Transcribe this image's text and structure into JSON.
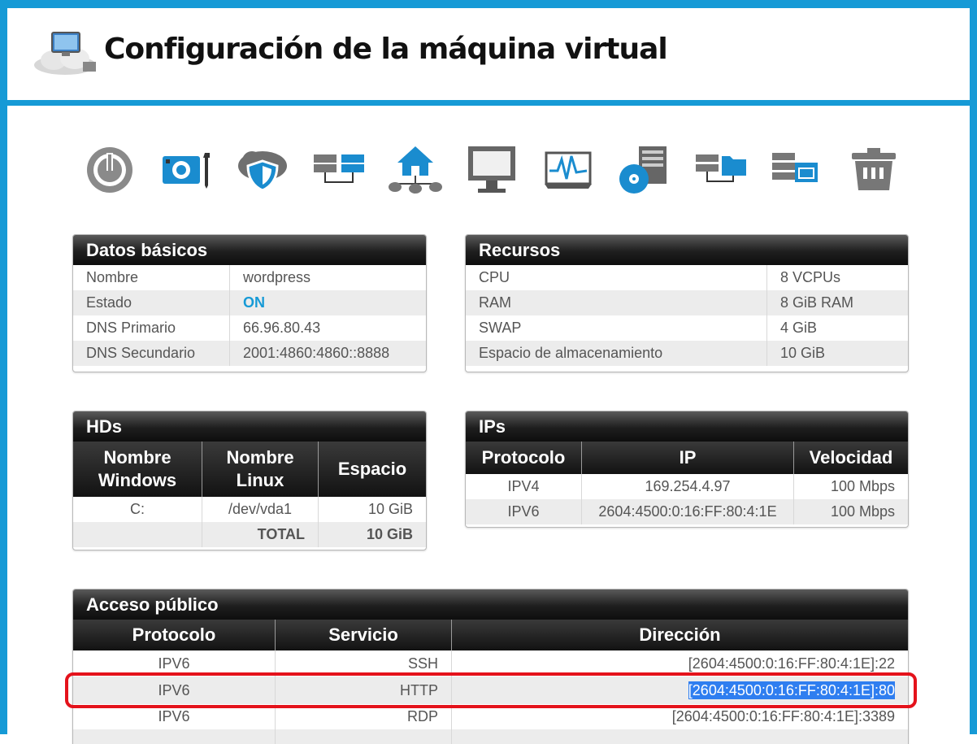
{
  "header": {
    "title": "Configuración de la máquina virtual",
    "logo_icon": "cloud-computer-icon"
  },
  "toolbar": {
    "icons": [
      "power-icon",
      "tools-icon",
      "shield-cloud-icon",
      "servers-icon",
      "network-home-icon",
      "monitor-icon",
      "activity-monitor-icon",
      "disk-server-icon",
      "server-folder-icon",
      "server-window-icon",
      "trash-icon"
    ]
  },
  "basic": {
    "title": "Datos básicos",
    "rows": [
      {
        "label": "Nombre",
        "value": "wordpress"
      },
      {
        "label": "Estado",
        "value": "ON"
      },
      {
        "label": "DNS Primario",
        "value": "66.96.80.43"
      },
      {
        "label": "DNS Secundario",
        "value": "2001:4860:4860::8888"
      }
    ]
  },
  "resources": {
    "title": "Recursos",
    "rows": [
      {
        "label": "CPU",
        "value": "8 VCPUs"
      },
      {
        "label": "RAM",
        "value": "8 GiB RAM"
      },
      {
        "label": "SWAP",
        "value": "4 GiB"
      },
      {
        "label": "Espacio de almacenamiento",
        "value": "10 GiB"
      }
    ]
  },
  "hds": {
    "title": "HDs",
    "headers": [
      "Nombre Windows",
      "Nombre Linux",
      "Espacio"
    ],
    "row": {
      "win": "C:",
      "linux": "/dev/vda1",
      "space": "10 GiB"
    },
    "total_label": "TOTAL",
    "total_value": "10 GiB"
  },
  "ips": {
    "title": "IPs",
    "headers": [
      "Protocolo",
      "IP",
      "Velocidad"
    ],
    "rows": [
      {
        "proto": "IPV4",
        "ip": "169.254.4.97",
        "speed": "100 Mbps"
      },
      {
        "proto": "IPV6",
        "ip": "2604:4500:0:16:FF:80:4:1E",
        "speed": "100 Mbps"
      }
    ]
  },
  "public": {
    "title": "Acceso público",
    "headers": [
      "Protocolo",
      "Servicio",
      "Dirección"
    ],
    "rows": [
      {
        "proto": "IPV6",
        "service": "SSH",
        "addr": "[2604:4500:0:16:FF:80:4:1E]:22"
      },
      {
        "proto": "IPV6",
        "service": "HTTP",
        "addr": "[2604:4500:0:16:FF:80:4:1E]:80"
      },
      {
        "proto": "IPV6",
        "service": "RDP",
        "addr": "[2604:4500:0:16:FF:80:4:1E]:3389"
      }
    ]
  },
  "colors": {
    "accent": "#169ad6",
    "highlight": "#e4121b",
    "selection": "#2f7ef0"
  }
}
